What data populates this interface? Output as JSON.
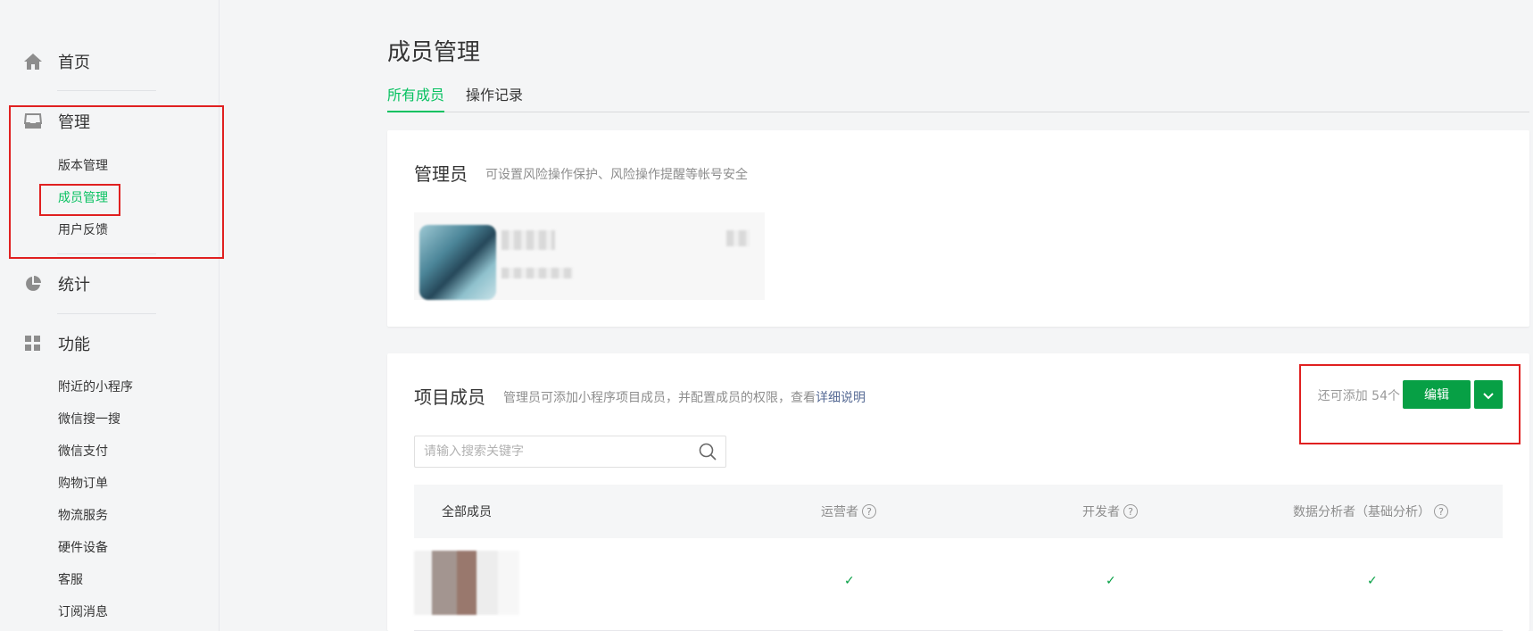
{
  "sidebar": {
    "home": {
      "label": "首页"
    },
    "manage": {
      "label": "管理",
      "items": [
        {
          "label": "版本管理"
        },
        {
          "label": "成员管理"
        },
        {
          "label": "用户反馈"
        }
      ]
    },
    "stats": {
      "label": "统计"
    },
    "features": {
      "label": "功能",
      "items": [
        {
          "label": "附近的小程序"
        },
        {
          "label": "微信搜一搜"
        },
        {
          "label": "微信支付"
        },
        {
          "label": "购物订单"
        },
        {
          "label": "物流服务"
        },
        {
          "label": "硬件设备"
        },
        {
          "label": "客服"
        },
        {
          "label": "订阅消息"
        }
      ]
    }
  },
  "page": {
    "title": "成员管理",
    "tabs": [
      {
        "label": "所有成员"
      },
      {
        "label": "操作记录"
      }
    ]
  },
  "admin": {
    "title": "管理员",
    "desc": "可设置风险操作保护、风险操作提醒等帐号安全"
  },
  "members": {
    "title": "项目成员",
    "desc": "管理员可添加小程序项目成员，并配置成员的权限，查看",
    "desc_link": "详细说明",
    "quota": "还可添加 54个",
    "edit_label": "编辑",
    "search_placeholder": "请输入搜索关键字",
    "columns": [
      {
        "label": "全部成员"
      },
      {
        "label": "运营者"
      },
      {
        "label": "开发者"
      },
      {
        "label": "数据分析者（基础分析）"
      }
    ],
    "rows": [
      {
        "checks": [
          "✓",
          "✓",
          "✓"
        ]
      }
    ]
  },
  "colors": {
    "accent": "#07c160",
    "button": "#07a045",
    "highlight_box": "#e02020",
    "link": "#576b95"
  }
}
